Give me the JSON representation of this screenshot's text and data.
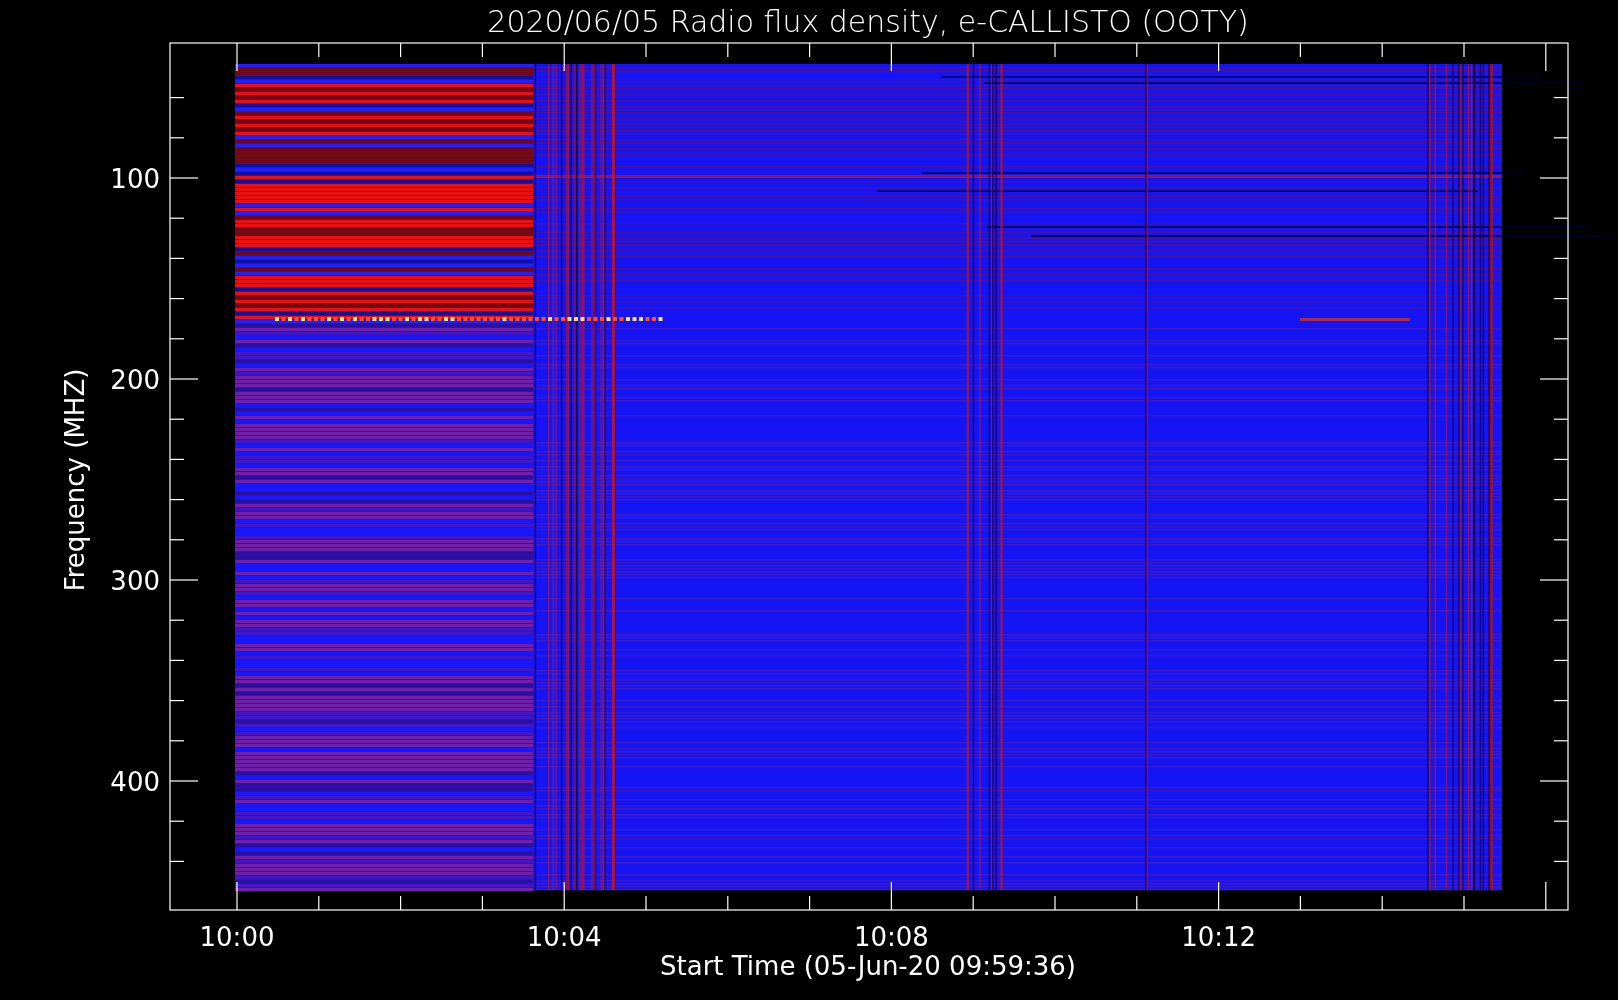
{
  "title": "2020/06/05  Radio flux density, e-CALLISTO (OOTY)",
  "y_axis": {
    "label": "Frequency (MHZ)",
    "ticks": [
      "100",
      "200",
      "300",
      "400"
    ]
  },
  "x_axis": {
    "label": "Start Time (05-Jun-20 09:59:36)",
    "ticks": [
      "10:00",
      "10:04",
      "10:08",
      "10:12"
    ]
  }
}
